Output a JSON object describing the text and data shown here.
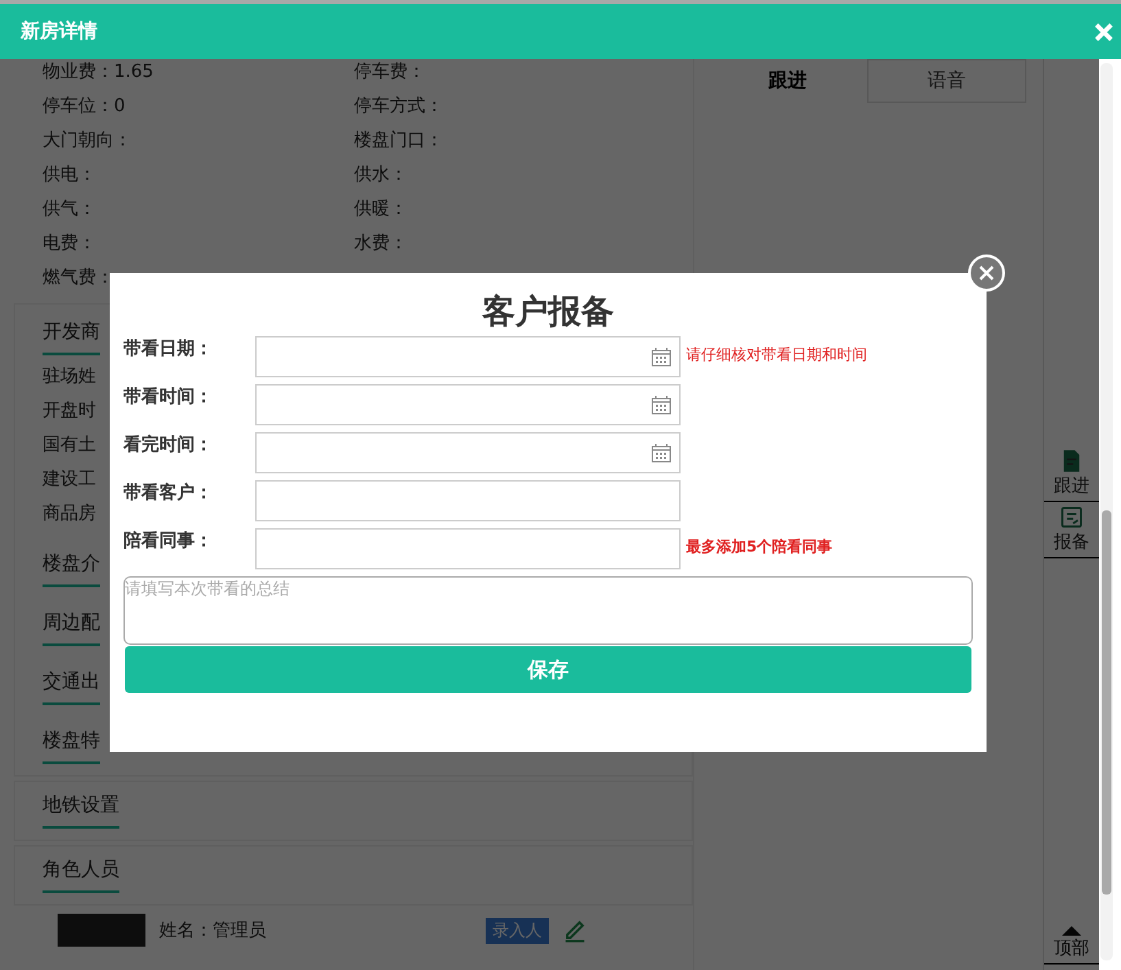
{
  "window": {
    "title": "新房详情"
  },
  "info_rows": [
    {
      "left": "物业费：1.65",
      "right": "停车费："
    },
    {
      "left": "停车位：0",
      "right": "停车方式："
    },
    {
      "left": "大门朝向：",
      "right": "楼盘门口："
    },
    {
      "left": "供电：",
      "right": "供水："
    },
    {
      "left": "供气：",
      "right": "供暖："
    },
    {
      "left": "电费：",
      "right": "水费："
    },
    {
      "left": "燃气费："
    }
  ],
  "sections": [
    {
      "title": "开发商",
      "rows": [
        "驻场姓",
        "开盘时",
        "国有土",
        "建设工",
        "商品房"
      ]
    },
    {
      "title": "楼盘介"
    },
    {
      "title": "周边配"
    },
    {
      "title": "交通出"
    },
    {
      "title": "楼盘特"
    }
  ],
  "cards": [
    {
      "title": "地铁设置"
    },
    {
      "title": "角色人员"
    }
  ],
  "member": {
    "name": "姓名：管理员",
    "badge": "录入人"
  },
  "tabs": [
    {
      "label": "跟进",
      "selected": true
    },
    {
      "label": "语音",
      "selected": false
    }
  ],
  "side_tools": [
    {
      "kind": "follow",
      "label": "跟进"
    },
    {
      "kind": "report",
      "label": "报备"
    }
  ],
  "top_button": "顶部",
  "dialog": {
    "title": "客户报备",
    "fields": [
      {
        "label": "带看日期：",
        "kind": "date",
        "hint": "请仔细核对带看日期和时间",
        "hint_bold": false
      },
      {
        "label": "带看时间：",
        "kind": "date"
      },
      {
        "label": "看完时间：",
        "kind": "date"
      },
      {
        "label": "带看客户：",
        "kind": "text"
      },
      {
        "label": "陪看同事：",
        "kind": "text",
        "hint": "最多添加5个陪看同事",
        "hint_bold": true
      }
    ],
    "summary_placeholder": "请填写本次带看的总结",
    "save": "保存"
  }
}
